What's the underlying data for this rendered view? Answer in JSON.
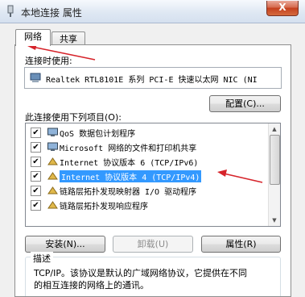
{
  "window": {
    "title": "本地连接 属性",
    "close_label": "X"
  },
  "tabs": [
    {
      "label": "网络"
    },
    {
      "label": "共享"
    }
  ],
  "connect_using": {
    "label": "连接时使用:",
    "adapter": "Realtek RTL8101E 系列 PCI-E 快速以太网 NIC (NI"
  },
  "buttons": {
    "configure": "配置(C)...",
    "install": "安装(N)...",
    "uninstall": "卸载(U)",
    "properties": "属性(R)"
  },
  "items_label": "此连接使用下列项目(O):",
  "items": [
    {
      "label": "QoS 数据包计划程序",
      "checked": true,
      "icon": "qos-icon"
    },
    {
      "label": "Microsoft 网络的文件和打印机共享",
      "checked": true,
      "icon": "network-share-icon"
    },
    {
      "label": "Internet 协议版本 6 (TCP/IPv6)",
      "checked": true,
      "icon": "protocol-icon"
    },
    {
      "label": "Internet 协议版本 4 (TCP/IPv4)",
      "checked": true,
      "icon": "protocol-icon",
      "selected": true
    },
    {
      "label": "链路层拓扑发现映射器 I/O 驱动程序",
      "checked": true,
      "icon": "protocol-icon"
    },
    {
      "label": "链路层拓扑发现响应程序",
      "checked": true,
      "icon": "protocol-icon"
    }
  ],
  "description": {
    "title": "描述",
    "text_line1": "TCP/IP。该协议是默认的广域网络协议，它提供在不同",
    "text_line2": "的相互连接的网络上的通讯。"
  },
  "colors": {
    "annotation_arrow": "#d6232a",
    "selection": "#3399ff"
  }
}
